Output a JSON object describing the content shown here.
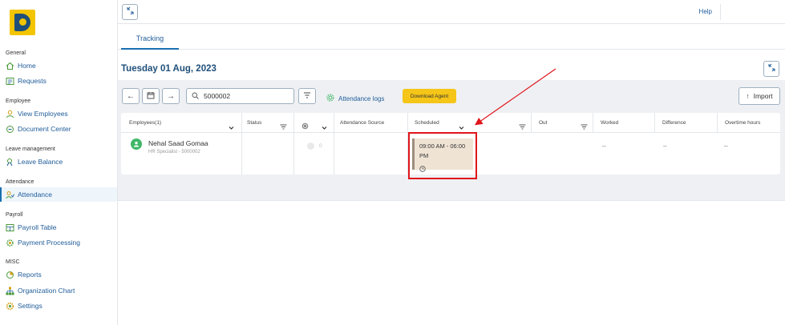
{
  "sidebar": {
    "sections": [
      {
        "title": "General",
        "items": [
          {
            "label": "Home",
            "icon": "home-icon"
          },
          {
            "label": "Requests",
            "icon": "requests-icon"
          }
        ]
      },
      {
        "title": "Employee",
        "items": [
          {
            "label": "View Employees",
            "icon": "user-icon"
          },
          {
            "label": "Document Center",
            "icon": "document-icon"
          }
        ]
      },
      {
        "title": "Leave management",
        "items": [
          {
            "label": "Leave Balance",
            "icon": "leave-icon"
          }
        ]
      },
      {
        "title": "Attendance",
        "items": [
          {
            "label": "Attendance",
            "icon": "attendance-icon",
            "active": true
          }
        ]
      },
      {
        "title": "Payroll",
        "items": [
          {
            "label": "Payroll Table",
            "icon": "table-icon"
          },
          {
            "label": "Payment Processing",
            "icon": "gear-icon"
          }
        ]
      },
      {
        "title": "MISC",
        "items": [
          {
            "label": "Reports",
            "icon": "pie-chart-icon"
          },
          {
            "label": "Organization Chart",
            "icon": "org-chart-icon"
          },
          {
            "label": "Settings",
            "icon": "settings-icon"
          }
        ]
      }
    ]
  },
  "topbar": {
    "help": "Help"
  },
  "tabs": [
    {
      "label": "Tracking",
      "active": true
    }
  ],
  "date_title": "Tuesday 01 Aug, 2023",
  "toolbar": {
    "search_value": "5000002",
    "attendance_logs": "Attendance logs",
    "download_agent": "Download Agent",
    "import": "Import"
  },
  "table": {
    "columns": [
      "Employees(1)",
      "Status",
      "",
      "Attendance Source",
      "Scheduled",
      "Out",
      "Worked",
      "Difference",
      "Overtime hours"
    ],
    "row": {
      "name": "Nehal Saad Gomaa",
      "subtitle": "HR Specialist - 5000002",
      "fingerprint_count": "0",
      "scheduled": "09:00 AM - 06:00 PM",
      "worked": "--",
      "difference": "--",
      "overtime": "--"
    }
  },
  "colors": {
    "accent": "#1f5c99",
    "highlight": "#e0151b",
    "download": "#f5c518",
    "avatar": "#3fb868"
  }
}
